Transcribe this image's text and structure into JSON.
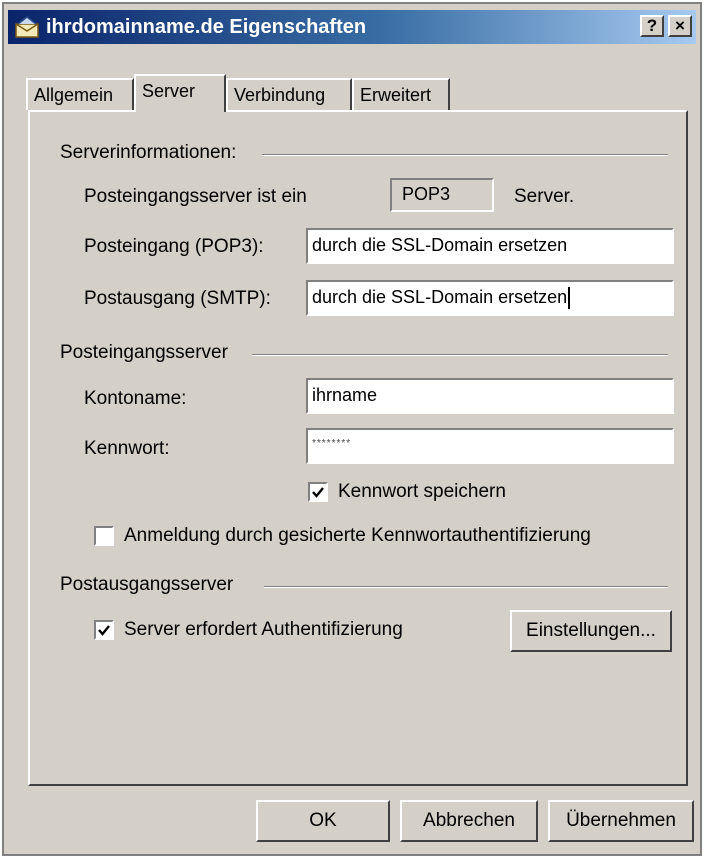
{
  "window": {
    "title": "ihrdomainname.de Eigenschaften",
    "help_button": "?",
    "close_button": "×"
  },
  "tabs": [
    {
      "label": "Allgemein",
      "active": false
    },
    {
      "label": "Server",
      "active": true
    },
    {
      "label": "Verbindung",
      "active": false
    },
    {
      "label": "Erweitert",
      "active": false
    }
  ],
  "server_info": {
    "group_label": "Serverinformationen:",
    "incoming_type_label": "Posteingangsserver ist ein",
    "incoming_type_value": "POP3",
    "incoming_type_suffix": "Server.",
    "incoming_label": "Posteingang (POP3):",
    "incoming_value": "durch die SSL-Domain ersetzen",
    "outgoing_label": "Postausgang (SMTP):",
    "outgoing_value": "durch die SSL-Domain ersetzen"
  },
  "incoming_server": {
    "group_label": "Posteingangsserver",
    "account_label": "Kontoname:",
    "account_value": "ihrname",
    "password_label": "Kennwort:",
    "password_value": "********",
    "save_password_label": "Kennwort speichern",
    "save_password_checked": true,
    "spa_label": "Anmeldung durch gesicherte Kennwortauthentifizierung",
    "spa_checked": false
  },
  "outgoing_server": {
    "group_label": "Postausgangsserver",
    "auth_label": "Server erfordert Authentifizierung",
    "auth_checked": true,
    "settings_button": "Einstellungen..."
  },
  "buttons": {
    "ok": "OK",
    "cancel": "Abbrechen",
    "apply": "Übernehmen"
  },
  "colors": {
    "dialog_bg": "#d4d0c8",
    "titlebar_start": "#0a246a",
    "titlebar_end": "#a6caf0"
  }
}
